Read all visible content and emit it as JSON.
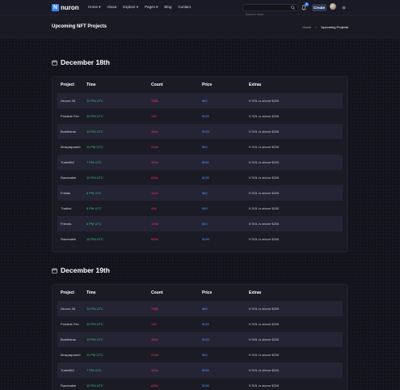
{
  "header": {
    "logo_letter": "N",
    "logo_text": "nuron",
    "nav": [
      "Home",
      "About",
      "Explore",
      "Pages",
      "Blog",
      "Contact"
    ],
    "search_placeholder": "Search Here",
    "notification_count": "1",
    "create_label": "Create"
  },
  "titlebar": {
    "title": "Upcoming NFT Projects",
    "breadcrumb_home": "Home",
    "breadcrumb_sep": ">",
    "breadcrumb_current": "Upcoming Projects"
  },
  "table_headers": [
    "Project",
    "Time",
    "Count",
    "Price",
    "Extras"
  ],
  "sections": [
    {
      "date": "December 18th",
      "rows": [
        [
          "Secure 25",
          "10 PM UTC",
          "798k",
          "$90",
          "If SOL is above $200"
        ],
        [
          "Portable Fire",
          "10 PM UTC",
          "10k",
          "$190",
          "If SOL is above $200"
        ],
        [
          "Buddistras",
          "10 PM UTC",
          "360k",
          "$200",
          "If SOL is above $200"
        ],
        [
          "Mospaquared",
          "11 PM UTC",
          "240k",
          "$90",
          "If SOL is above $200"
        ],
        [
          "Trads562",
          "7 PM UTC",
          "340k",
          "$560",
          "If SOL is above $200"
        ],
        [
          "Ranesable",
          "10 PM UTC",
          "640k",
          "$190",
          "If SOL is above $200"
        ],
        [
          "Fristas",
          "6 PM UTC",
          "140k",
          "$80",
          "If SOL is above $200"
        ],
        [
          "Thafind",
          "5 PM UTC",
          "40k",
          "$90",
          "If SOL is above $200"
        ],
        [
          "Friends",
          "6 PM UTC",
          "140k",
          "$20",
          "If SOL is above $200"
        ],
        [
          "Ranesable",
          "10 PM UTC",
          "840k",
          "$190",
          "If SOL is above $200"
        ]
      ]
    },
    {
      "date": "December 19th",
      "rows": [
        [
          "Secure 25",
          "10 PM UTC",
          "798k",
          "$90",
          "If SOL is above $200"
        ],
        [
          "Portable Fire",
          "10 PM UTC",
          "10k",
          "$190",
          "If SOL is above $200"
        ],
        [
          "Buddistras",
          "10 PM UTC",
          "360k",
          "$200",
          "If SOL is above $200"
        ],
        [
          "Mospaquared",
          "11 PM UTC",
          "240k",
          "$90",
          "If SOL is above $200"
        ],
        [
          "Trads562",
          "7 PM UTC",
          "340k",
          "$560",
          "If SOL is above $200"
        ],
        [
          "Ranesable",
          "10 PM UTC",
          "640k",
          "$190",
          "If SOL is above $200"
        ]
      ]
    }
  ]
}
